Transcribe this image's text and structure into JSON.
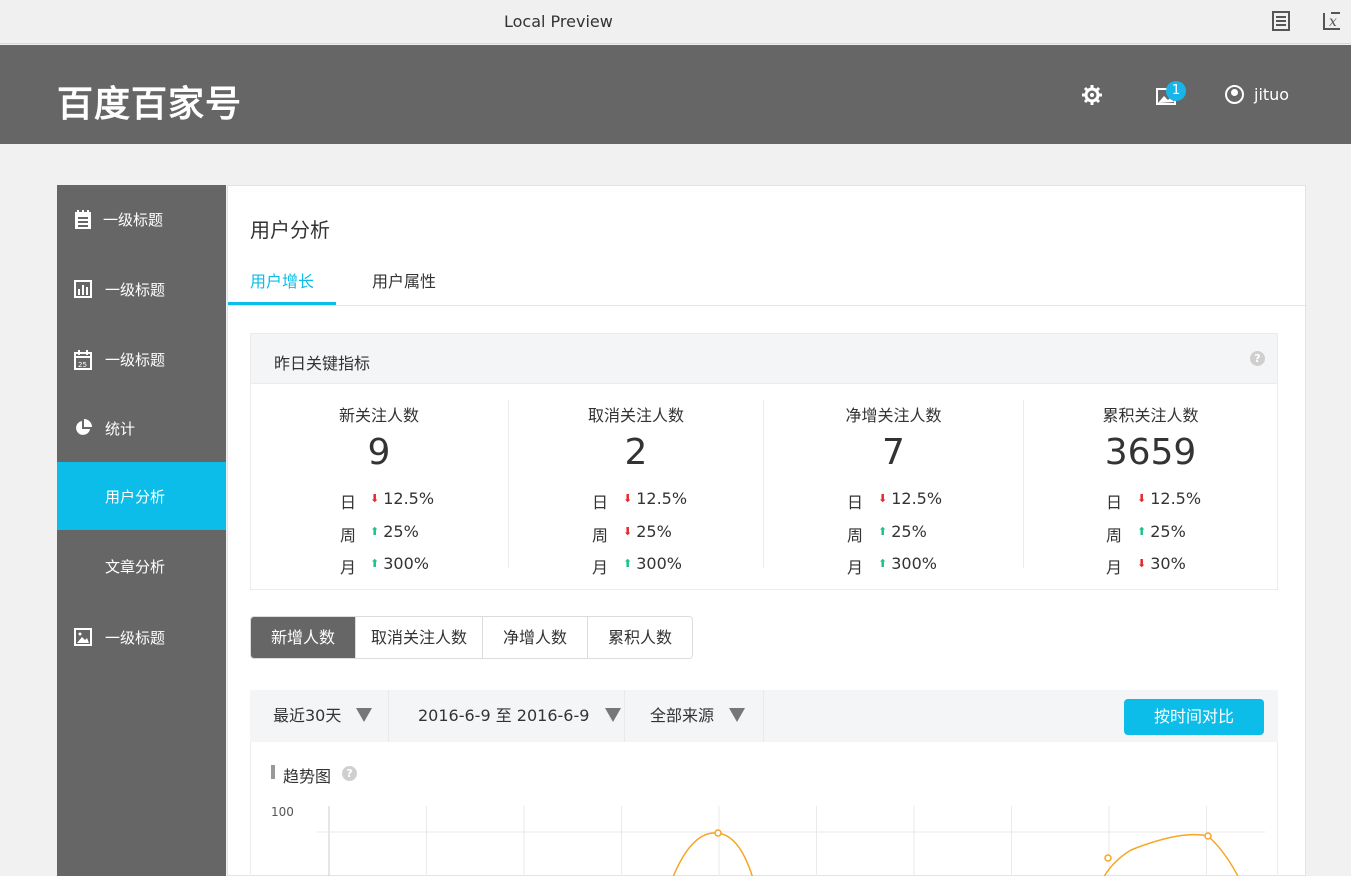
{
  "window": {
    "title": "Local Preview",
    "icons": [
      "document-icon",
      "close-x-icon"
    ]
  },
  "header": {
    "logo": "百度百家号",
    "notification_count": "1",
    "username": "jituo"
  },
  "sidebar": {
    "items": [
      {
        "label": "一级标题",
        "icon": "notepad-icon"
      },
      {
        "label": "一级标题",
        "icon": "bar-chart-icon"
      },
      {
        "label": "一级标题",
        "icon": "calendar-icon",
        "icon_text": "25"
      },
      {
        "label": "统计",
        "icon": "pie-chart-icon"
      },
      {
        "label": "用户分析",
        "active": true
      },
      {
        "label": "文章分析"
      },
      {
        "label": "一级标题",
        "icon": "image-icon"
      }
    ]
  },
  "main": {
    "title": "用户分析",
    "tabs": [
      {
        "label": "用户增长",
        "active": true
      },
      {
        "label": "用户属性"
      }
    ]
  },
  "kpi": {
    "title": "昨日关键指标",
    "help": "?",
    "metrics": [
      {
        "name": "新关注人数",
        "value": "9",
        "rows": [
          {
            "key": "日",
            "dir": "down",
            "val": "12.5%"
          },
          {
            "key": "周",
            "dir": "up",
            "val": "25%"
          },
          {
            "key": "月",
            "dir": "up",
            "val": "300%"
          }
        ]
      },
      {
        "name": "取消关注人数",
        "value": "2",
        "rows": [
          {
            "key": "日",
            "dir": "down",
            "val": "12.5%"
          },
          {
            "key": "周",
            "dir": "down",
            "val": "25%"
          },
          {
            "key": "月",
            "dir": "up",
            "val": "300%"
          }
        ]
      },
      {
        "name": "净增关注人数",
        "value": "7",
        "rows": [
          {
            "key": "日",
            "dir": "down",
            "val": "12.5%"
          },
          {
            "key": "周",
            "dir": "up",
            "val": "25%"
          },
          {
            "key": "月",
            "dir": "up",
            "val": "300%"
          }
        ]
      },
      {
        "name": "累积关注人数",
        "value": "3659",
        "rows": [
          {
            "key": "日",
            "dir": "down",
            "val": "12.5%"
          },
          {
            "key": "周",
            "dir": "up",
            "val": "25%"
          },
          {
            "key": "月",
            "dir": "down",
            "val": "30%"
          }
        ]
      }
    ]
  },
  "segments": [
    {
      "label": "新增人数",
      "active": true
    },
    {
      "label": "取消关注人数"
    },
    {
      "label": "净增人数"
    },
    {
      "label": "累积人数"
    }
  ],
  "filters": {
    "range": "最近30天",
    "dates": "2016-6-9 至 2016-6-9",
    "source": "全部来源",
    "compare_button": "按时间对比"
  },
  "trend": {
    "title": "趋势图",
    "help": "?",
    "accent_color": "#f5a623"
  },
  "chart_data": {
    "type": "line",
    "yticks": [
      "100"
    ],
    "series": [
      {
        "values": [
          null,
          null,
          null,
          null,
          95,
          null,
          null,
          null,
          null,
          85,
          95
        ]
      }
    ]
  }
}
